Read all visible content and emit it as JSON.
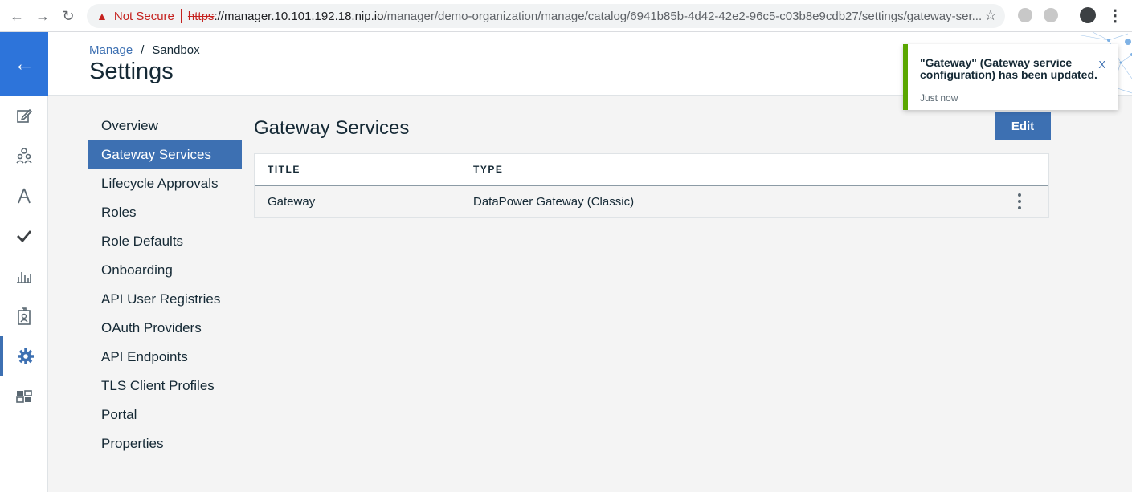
{
  "browser": {
    "security_label": "Not Secure",
    "url_scheme": "https",
    "url_sep": "://",
    "url_host": "manager.10.101.192.18.nip.io",
    "url_path": "/manager/demo-organization/manage/catalog/6941b85b-4d42-42e2-96c5-c03b8e9cdb27/settings/gateway-ser...",
    "icons": [
      "back-icon",
      "forward-icon",
      "reload-icon",
      "warning-icon",
      "star-icon",
      "profile-icon",
      "menu-icon"
    ]
  },
  "rail": {
    "back_icon": "arrow-left-icon",
    "items": [
      "edit-icon",
      "people-icon",
      "compass-icon",
      "check-icon",
      "analytics-icon",
      "badge-icon",
      "gear-icon",
      "dashboard-icon"
    ],
    "active_item": "gear-icon",
    "accent": "#3d70b2",
    "back_bg": "#2d74da"
  },
  "header": {
    "breadcrumb_parent": "Manage",
    "breadcrumb_sep": "/",
    "breadcrumb_current": "Sandbox",
    "title": "Settings"
  },
  "settings_nav": {
    "items": [
      {
        "label": "Overview"
      },
      {
        "label": "Gateway Services"
      },
      {
        "label": "Lifecycle Approvals"
      },
      {
        "label": "Roles"
      },
      {
        "label": "Role Defaults"
      },
      {
        "label": "Onboarding"
      },
      {
        "label": "API User Registries"
      },
      {
        "label": "OAuth Providers"
      },
      {
        "label": "API Endpoints"
      },
      {
        "label": "TLS Client Profiles"
      },
      {
        "label": "Portal"
      },
      {
        "label": "Properties"
      }
    ],
    "active": "Gateway Services"
  },
  "main": {
    "title": "Gateway Services",
    "edit_label": "Edit",
    "table": {
      "headers": [
        "TITLE",
        "TYPE"
      ],
      "rows": [
        {
          "title": "Gateway",
          "type": "DataPower Gateway (Classic)"
        }
      ]
    }
  },
  "toast": {
    "message": "\"Gateway\" (Gateway service configuration) has been updated.",
    "time": "Just now",
    "close_label": "X",
    "accent": "#5aa700"
  }
}
